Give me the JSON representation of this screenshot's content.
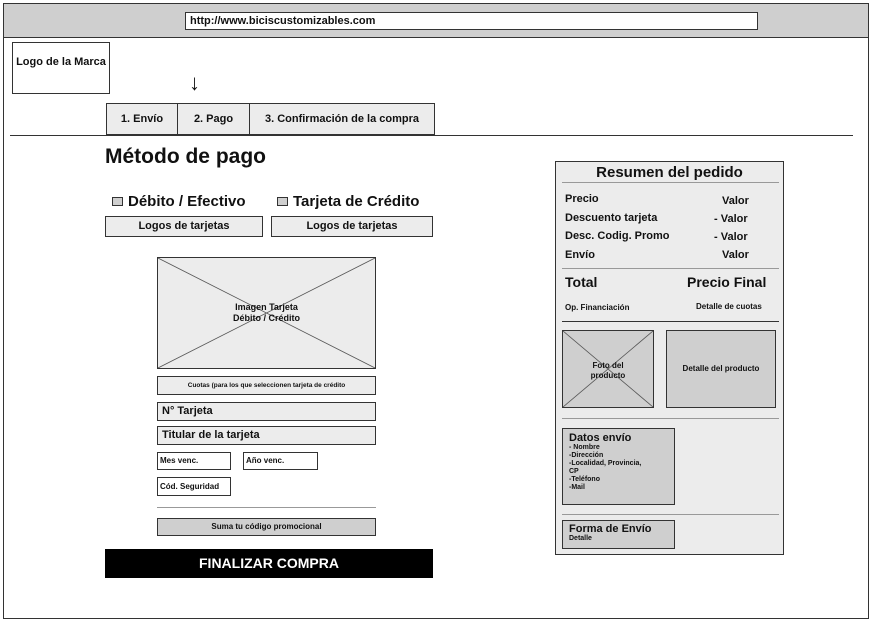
{
  "browser": {
    "url": "http://www.biciscustomizables.com"
  },
  "brand": {
    "logo_text": "Logo de la Marca"
  },
  "steps": [
    {
      "label": "1. Envío"
    },
    {
      "label": "2. Pago"
    },
    {
      "label": "3. Confirmación de la compra"
    }
  ],
  "current_step_indicator": "↓",
  "payment": {
    "title": "Método de pago",
    "option_debit": "Débito / Efectivo",
    "option_credit": "Tarjeta de Crédito",
    "logos_debit": "Logos de tarjetas",
    "logos_credit": "Logos de tarjetas",
    "card_image_text_1": "Imagen Tarjeta",
    "card_image_text_2": "Débito / Crédito",
    "cuotas_label": "Cuotas (para los que seleccionen tarjeta de crédito",
    "card_number_label": "N° Tarjeta",
    "card_holder_label": "Titular de la tarjeta",
    "month_label": "Mes venc.",
    "year_label": "Año venc.",
    "security_label": "Cód. Seguridad",
    "promo_label": "Suma tu código promocional",
    "finish_button": "FINALIZAR COMPRA"
  },
  "summary": {
    "title": "Resumen del pedido",
    "rows": [
      {
        "label": "Precio",
        "value": "Valor"
      },
      {
        "label": "Descuento tarjeta",
        "value": "- Valor"
      },
      {
        "label": "Desc. Codig. Promo",
        "value": "- Valor"
      },
      {
        "label": "Envío",
        "value": "Valor"
      }
    ],
    "total_label": "Total",
    "total_value": "Precio Final",
    "financing_label": "Op. Financiación",
    "financing_value": "Detalle de cuotas",
    "photo_text_1": "Foto del",
    "photo_text_2": "producto",
    "product_detail": "Detalle del producto",
    "shipping_title": "Datos envío",
    "shipping_items": [
      "- Nombre",
      "-Dirección",
      "-Localidad, Provincia,",
      "CP",
      "-Teléfono",
      "-Mail"
    ],
    "delivery_title": "Forma de Envío",
    "delivery_detail": "Detalle"
  }
}
